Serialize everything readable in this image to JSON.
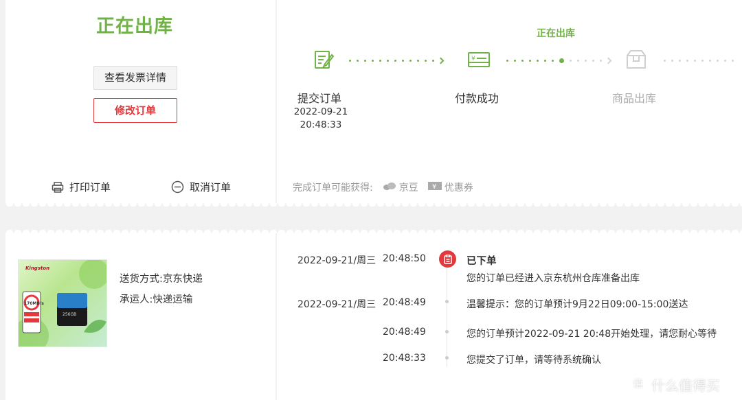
{
  "order_status": {
    "title": "正在出库"
  },
  "buttons": {
    "invoice": "查看发票详情",
    "modify": "修改订单"
  },
  "actions": {
    "print": "打印订单",
    "cancel": "取消订单"
  },
  "progress": {
    "current_label": "正在出库",
    "steps": [
      {
        "label": "提交订单",
        "date": "2022-09-21",
        "time": "20:48:33",
        "icon": "edit-document-icon",
        "state": "done"
      },
      {
        "label": "付款成功",
        "icon": "payment-card-icon",
        "state": "done"
      },
      {
        "label": "商品出库",
        "icon": "package-box-icon",
        "state": "pending"
      }
    ]
  },
  "rewards": {
    "label": "完成订单可能获得:",
    "items": [
      {
        "label": "京豆",
        "icon": "jingdou-icon"
      },
      {
        "label": "优惠券",
        "icon": "coupon-icon"
      }
    ]
  },
  "shipping": {
    "method_label": "送货方式:",
    "method": "京东快递",
    "carrier_label": "承运人:",
    "carrier": "快递运输"
  },
  "product_image": {
    "brand_text": "Kingston",
    "speed_text": "170MB/s",
    "capacity_text": "256GB"
  },
  "logistics": [
    {
      "date": "2022-09-21/周三",
      "time": "20:48:50",
      "title": "已下单",
      "text": "您的订单已经进入京东杭州仓库准备出库"
    },
    {
      "date": "2022-09-21/周三",
      "time": "20:48:49",
      "text": "温馨提示：您的订单预计9月22日09:00-15:00送达"
    },
    {
      "date": "",
      "time": "20:48:49",
      "text": "您的订单预计2022-09-21 20:48开始处理，请您耐心等待"
    },
    {
      "date": "",
      "time": "20:48:33",
      "text": "您提交了订单，请等待系统确认"
    }
  ],
  "watermark": {
    "text": "什么值得买",
    "icon": "smzdm-logo-icon"
  },
  "colors": {
    "accent_green": "#71b247",
    "accent_red": "#e4393c",
    "gray": "#aaaaaa"
  }
}
